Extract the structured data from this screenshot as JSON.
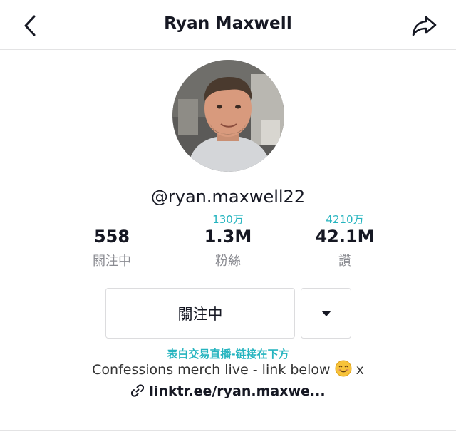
{
  "header": {
    "title": "Ryan Maxwell"
  },
  "profile": {
    "handle": "@ryan.maxwell22"
  },
  "stats": [
    {
      "translation": "",
      "value": "558",
      "label": "關注中"
    },
    {
      "translation": "130万",
      "value": "1.3M",
      "label": "粉絲"
    },
    {
      "translation": "4210万",
      "value": "42.1M",
      "label": "讚"
    }
  ],
  "actions": {
    "follow_label": "關注中"
  },
  "bio": {
    "translation": "表白交易直播-链接在下方",
    "text": "Confessions merch live - link below",
    "suffix": " x",
    "emoji": "smiling-face-emoji"
  },
  "link": {
    "text": "linktr.ee/ryan.maxwe..."
  },
  "icons": {
    "back": "chevron-left-icon",
    "share": "share-arrow-icon",
    "dropdown": "caret-down-icon",
    "link": "link-icon"
  },
  "colors": {
    "accent": "#25b4bf",
    "text": "#161823",
    "muted": "#8a8b91"
  }
}
